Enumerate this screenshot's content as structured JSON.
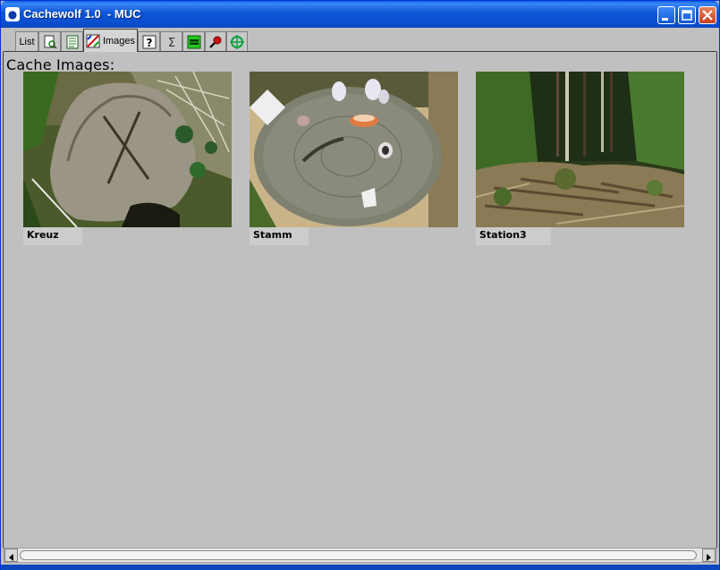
{
  "window": {
    "title": "Cachewolf 1.0  - MUC",
    "app_icon": "cachewolf-app-icon"
  },
  "tabs": [
    {
      "name": "tab-list",
      "label": "List",
      "icon": null,
      "active": false
    },
    {
      "name": "tab-details",
      "label": "",
      "icon": "page-magnifier-icon",
      "active": false
    },
    {
      "name": "tab-description",
      "label": "",
      "icon": "text-document-icon",
      "active": false
    },
    {
      "name": "tab-images",
      "label": "Images",
      "icon": "picture-icon",
      "active": true
    },
    {
      "name": "tab-hints",
      "label": "",
      "icon": "question-mark-icon",
      "active": false
    },
    {
      "name": "tab-calculator",
      "label": "",
      "icon": "sigma-icon",
      "active": false
    },
    {
      "name": "tab-solver",
      "label": "",
      "icon": "green-frame-icon",
      "active": false
    },
    {
      "name": "tab-radar",
      "label": "",
      "icon": "magnifier-red-icon",
      "active": false
    },
    {
      "name": "tab-goto",
      "label": "",
      "icon": "crosshair-icon",
      "active": false
    }
  ],
  "images_panel": {
    "title": "Cache Images:",
    "images": [
      {
        "caption": "Kreuz",
        "subject": "tree-stump-with-carved-cross-photo"
      },
      {
        "caption": "Stamm",
        "subject": "log-cross-section-with-mushrooms-photo"
      },
      {
        "caption": "Station3",
        "subject": "forest-clearing-photo"
      }
    ]
  },
  "colors": {
    "titlebar": "#0a4fcf",
    "window_bg": "#c0c0c0",
    "close_button": "#c8401c"
  }
}
